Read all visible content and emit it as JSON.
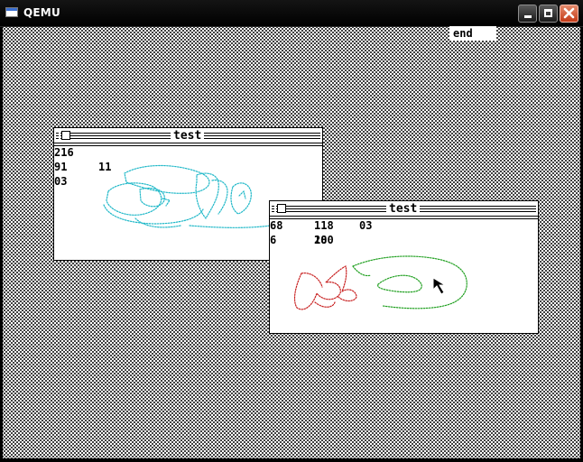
{
  "host": {
    "title": "QEMU",
    "icons": [
      "app-window-icon",
      "minimize-icon",
      "maximize-icon",
      "close-icon"
    ],
    "close_color": "#c43a17"
  },
  "desktop": {
    "end_label": "end"
  },
  "windows": [
    {
      "title": "test",
      "numbers": [
        "216",
        "91",
        "11",
        "03"
      ],
      "drawing_color": "#1fb8c8"
    },
    {
      "title": "test",
      "numbers": [
        "68",
        "118",
        "03",
        "6",
        "100",
        "28"
      ],
      "drawing_colors": [
        "#c82020",
        "#20a020"
      ]
    }
  ],
  "cursor": "arrow-cursor-icon"
}
